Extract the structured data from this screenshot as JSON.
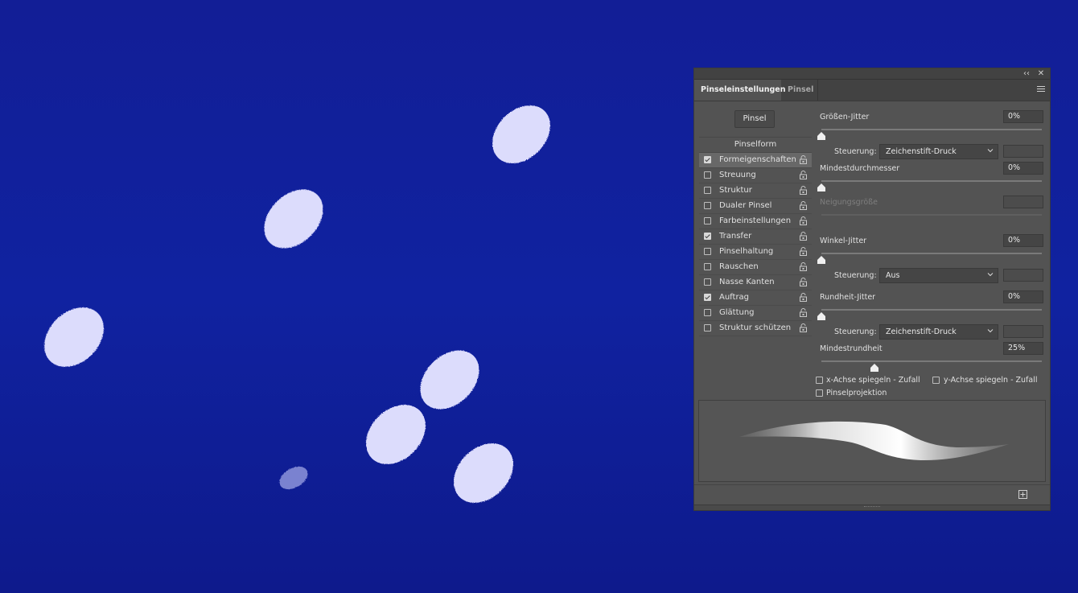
{
  "panel": {
    "tabs": [
      {
        "label": "Pinseleinstellungen",
        "active": true
      },
      {
        "label": "Pinsel",
        "active": false
      }
    ],
    "controls": {
      "collapse_glyph": "‹‹",
      "close_glyph": "✕"
    },
    "brush_button": "Pinsel",
    "list_header": "Pinselform",
    "list_items": [
      {
        "label": "Formeigenschaften",
        "checked": true,
        "selected": true
      },
      {
        "label": "Streuung",
        "checked": false
      },
      {
        "label": "Struktur",
        "checked": false
      },
      {
        "label": "Dualer Pinsel",
        "checked": false
      },
      {
        "label": "Farbeinstellungen",
        "checked": false
      },
      {
        "label": "Transfer",
        "checked": true
      },
      {
        "label": "Pinselhaltung",
        "checked": false
      },
      {
        "label": "Rauschen",
        "checked": false
      },
      {
        "label": "Nasse Kanten",
        "checked": false
      },
      {
        "label": "Auftrag",
        "checked": true
      },
      {
        "label": "Glättung",
        "checked": false
      },
      {
        "label": "Struktur schützen",
        "checked": false
      }
    ],
    "settings": {
      "size_jitter": {
        "label": "Größen-Jitter",
        "value": "0%",
        "slider": 0
      },
      "size_control": {
        "label": "Steuerung:",
        "value": "Zeichenstift-Druck"
      },
      "min_diameter": {
        "label": "Mindestdurchmesser",
        "value": "0%",
        "slider": 0
      },
      "tilt_scale": {
        "label": "Neigungsgröße",
        "value": "",
        "disabled": true
      },
      "angle_jitter": {
        "label": "Winkel-Jitter",
        "value": "0%",
        "slider": 0
      },
      "angle_control": {
        "label": "Steuerung:",
        "value": "Aus"
      },
      "roundness_jitter": {
        "label": "Rundheit-Jitter",
        "value": "0%",
        "slider": 0
      },
      "roundness_control": {
        "label": "Steuerung:",
        "value": "Zeichenstift-Druck"
      },
      "min_roundness": {
        "label": "Mindestrundheit",
        "value": "25%",
        "slider": 0.25
      }
    },
    "flip_x": {
      "label": "x-Achse spiegeln - Zufall",
      "checked": false
    },
    "flip_y": {
      "label": "y-Achse spiegeln - Zufall",
      "checked": false
    },
    "projection": {
      "label": "Pinselprojektion",
      "checked": false
    },
    "icons": {
      "lock": "lock-icon",
      "menu": "panel-menu-icon",
      "new": "new-brush-icon",
      "chevron": "chevron-down-icon"
    }
  },
  "colors": {
    "canvas": "#121e96",
    "dab": "#dcdcfc",
    "panel": "#535353"
  }
}
